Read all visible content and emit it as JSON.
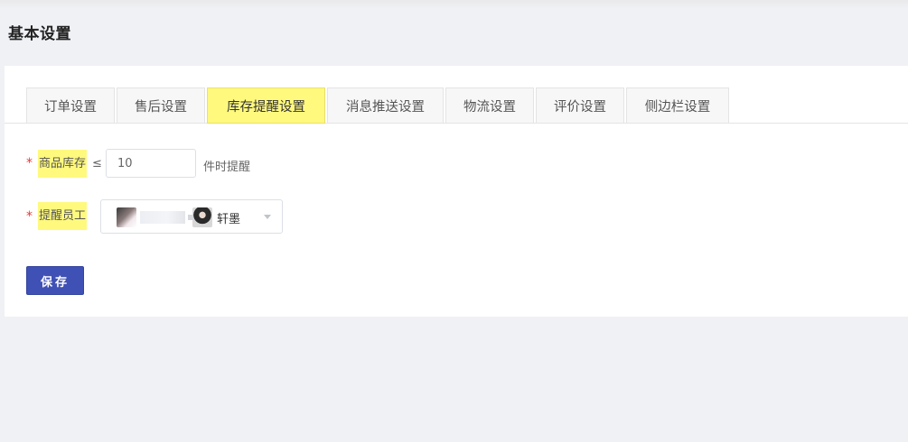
{
  "header": {
    "title": "基本设置"
  },
  "tabs": [
    {
      "label": "订单设置",
      "active": false
    },
    {
      "label": "售后设置",
      "active": false
    },
    {
      "label": "库存提醒设置",
      "active": true
    },
    {
      "label": "消息推送设置",
      "active": false
    },
    {
      "label": "物流设置",
      "active": false
    },
    {
      "label": "评价设置",
      "active": false
    },
    {
      "label": "侧边栏设置",
      "active": false
    }
  ],
  "form": {
    "required_mark": "*",
    "stock_label": "商品库存",
    "stock_operator": "≤",
    "stock_value": "10",
    "stock_suffix": "件时提醒",
    "staff_label": "提醒员工",
    "staff": [
      {
        "name": "",
        "avatar": "avatar-icon"
      },
      {
        "name": "轩墨",
        "avatar": "avatar-icon"
      }
    ],
    "save_label": "保存"
  },
  "colors": {
    "highlight": "#fff97e",
    "primary": "#3f51b5",
    "required": "#e23b3b"
  }
}
